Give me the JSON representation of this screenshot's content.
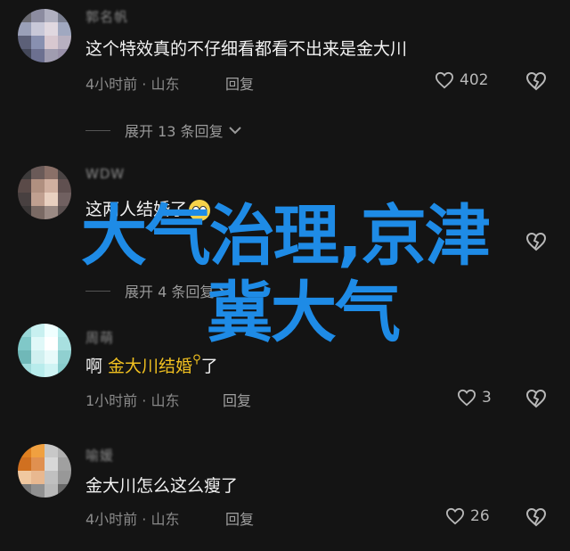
{
  "comments": [
    {
      "username": "郭名帆",
      "text": "这个特效真的不仔细看都看不出来是金大川",
      "meta": "4小时前 · 山东",
      "reply_label": "回复",
      "likes": "402",
      "avatar_colors": [
        "#6a6a72",
        "#8c8ca0",
        "#b0b0c0",
        "#7a7f90",
        "#9aa0b8",
        "#c8c8d8",
        "#e0d8e0",
        "#a0a8c0",
        "#5c6078",
        "#8890b0",
        "#d8c8d0",
        "#b8b0c0",
        "#44485a",
        "#6c7090",
        "#a09cb0",
        "#9890a8"
      ]
    },
    {
      "username": "WDW",
      "text": "这两人结婚了",
      "meta": "",
      "reply_label": "",
      "likes": "",
      "avatar_colors": [
        "#3c3a3a",
        "#6a5a58",
        "#8a7068",
        "#4a4444",
        "#5a4a48",
        "#b09080",
        "#d0b0a0",
        "#605050",
        "#484040",
        "#c0a090",
        "#e8d0c0",
        "#706060",
        "#3a3636",
        "#7a6a64",
        "#9a8a84",
        "#5a5050"
      ]
    },
    {
      "username": "周萌",
      "text_prefix": "啊 ",
      "text_highlight": "金大川结婚",
      "text_suffix": "了",
      "meta": "1小时前 · 山东",
      "reply_label": "回复",
      "likes": "3",
      "avatar_colors": [
        "#9ad8d8",
        "#c8f0f0",
        "#f0ffff",
        "#b0e8e8",
        "#80c8c8",
        "#e0f8f8",
        "#ffffff",
        "#a8e0e0",
        "#70b8b8",
        "#d0f0f0",
        "#e8fafa",
        "#90d0d0",
        "#a0dcdc",
        "#b8ecec",
        "#cff4f4",
        "#88cccc"
      ]
    },
    {
      "username": "喻媛",
      "text": "金大川怎么这么瘦了",
      "meta": "4小时前 · 山东",
      "reply_label": "回复",
      "likes": "26",
      "avatar_colors": [
        "#e08020",
        "#f0a040",
        "#c8c8c8",
        "#b0b0b0",
        "#d07020",
        "#e09050",
        "#d8d8d8",
        "#a0a0a0",
        "#f0c8a0",
        "#e8b890",
        "#c0c0c0",
        "#989898",
        "#787878",
        "#909090",
        "#b8b8b8",
        "#686868"
      ]
    }
  ],
  "expand_replies": [
    {
      "label": "展开 13 条回复"
    },
    {
      "label": "展开 4 条回复"
    }
  ],
  "overlay": {
    "line1": "大气治理,京津",
    "line2": "冀大气",
    "color": "#1e8be6"
  }
}
